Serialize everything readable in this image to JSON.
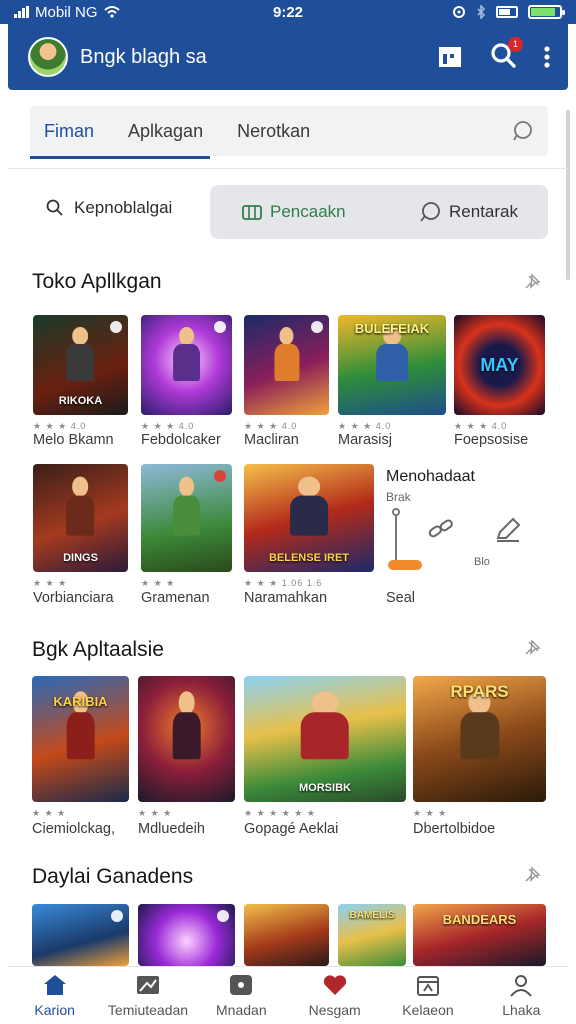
{
  "status_bar": {
    "carrier": "Mobil NG",
    "time": "9:22"
  },
  "app_bar": {
    "title": "Bngk blagh sa",
    "notification_count": "1"
  },
  "tabs": {
    "items": [
      "Fiman",
      "Aplkagan",
      "Nerotkan"
    ],
    "active_index": 0
  },
  "filters": {
    "left_label": "Kepnoblalgai",
    "pill_primary": "Pencaakn",
    "pill_secondary": "Rentarak"
  },
  "sections": [
    {
      "title": "Toko Apllkgan",
      "row1": [
        {
          "name": "Melo Bkamn",
          "cover": "RIKOKA",
          "meta": "★ ★ ★   4.0"
        },
        {
          "name": "Febdolcaker",
          "cover": "",
          "meta": "★ ★ ★   4.0"
        },
        {
          "name": "Macliran",
          "cover": "",
          "meta": "★ ★ ★   4.0"
        },
        {
          "name": "Marasisj",
          "cover": "BULEFEIAK",
          "meta": "★ ★ ★   4.0"
        },
        {
          "name": "Foepsosise",
          "cover": "MAY",
          "meta": "★ ★ ★   4.0"
        }
      ],
      "row2": [
        {
          "name": "Vorbianciara",
          "cover": "DINGS",
          "meta": "★ ★ ★"
        },
        {
          "name": "Gramenan",
          "cover": "",
          "meta": "★ ★ ★"
        },
        {
          "name": "Naramahkan",
          "cover": "BELENSE IRET",
          "meta": "★ ★ ★ 1.06  1.6"
        }
      ],
      "side_panel": {
        "title": "Menohadaat",
        "subtitle": "Brak",
        "value": "Blo",
        "label": "Seal"
      }
    },
    {
      "title": "Bgk Apltaalsie",
      "items": [
        {
          "name": "Ciemiolckag,",
          "cover": "KARIBIA",
          "meta": "★ ★ ★"
        },
        {
          "name": "Mdluedeih",
          "cover": "",
          "meta": "★ ★ ★"
        },
        {
          "name": "Gopagé Aeklai",
          "cover": "MORSIBK",
          "meta": "★ ★ ★ ★ ★ ★"
        },
        {
          "name": "Dbertolbidoe",
          "cover": "RPARS",
          "meta": "★ ★ ★"
        }
      ]
    },
    {
      "title": "Daylai Ganadens",
      "items": [
        {
          "cover": ""
        },
        {
          "cover": ""
        },
        {
          "cover": ""
        },
        {
          "cover": "BAMELIS"
        },
        {
          "cover": "BANDEARS"
        }
      ]
    }
  ],
  "bottom_nav": [
    {
      "label": "Karion",
      "icon": "home-icon"
    },
    {
      "label": "Temiuteadan",
      "icon": "image-icon"
    },
    {
      "label": "Mnadan",
      "icon": "wallet-icon"
    },
    {
      "label": "Nesgam",
      "icon": "heart-icon"
    },
    {
      "label": "Kelaeon",
      "icon": "calendar-icon"
    },
    {
      "label": "Lhaka",
      "icon": "person-icon"
    }
  ],
  "colors": {
    "primary": "#1f4e9b",
    "accent_green": "#2f7d4a",
    "badge_red": "#d8262b",
    "slider_orange": "#f08a2a"
  }
}
